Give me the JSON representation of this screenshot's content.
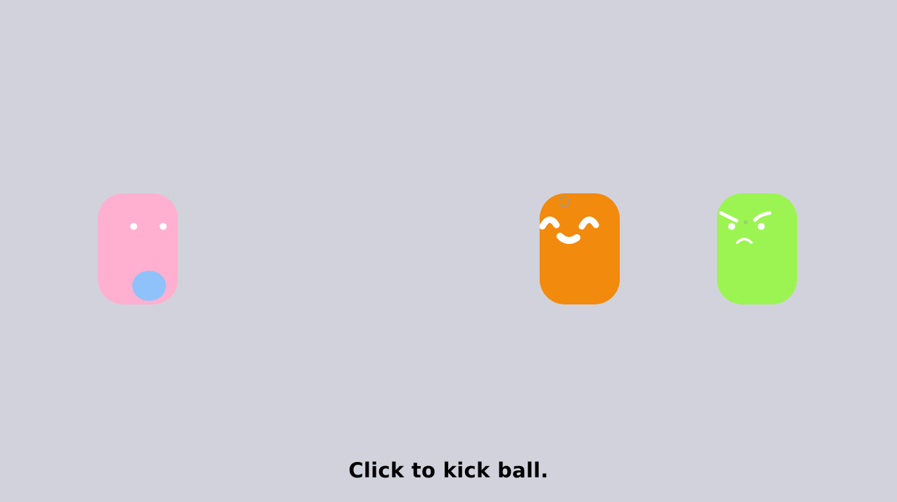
{
  "game": {
    "instruction": "Click to kick ball.",
    "background_color": "#d2d2dc"
  },
  "characters": [
    {
      "name": "pink",
      "color": "#ffb0d0",
      "expression": "neutral-eyes"
    },
    {
      "name": "orange",
      "color": "#f28a0e",
      "expression": "happy"
    },
    {
      "name": "green",
      "color": "#9cf452",
      "expression": "angry"
    }
  ],
  "ball": {
    "color": "#8fc2fa"
  },
  "colors": {
    "face_features": "#ffffff",
    "ring_marker": "#9a9a9a"
  }
}
